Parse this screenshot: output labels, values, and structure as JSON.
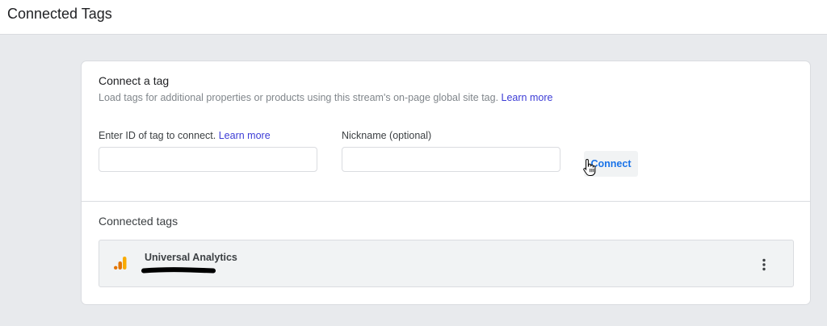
{
  "header": {
    "title": "Connected Tags"
  },
  "connect_section": {
    "title": "Connect a tag",
    "description": "Load tags for additional properties or products using this stream's on-page global site tag.",
    "description_link": "Learn more",
    "tag_id_label": "Enter ID of tag to connect.",
    "tag_id_link": "Learn more",
    "tag_id_value": "",
    "nickname_label": "Nickname (optional)",
    "nickname_value": "",
    "connect_button": "Connect"
  },
  "connected_section": {
    "title": "Connected tags",
    "items": [
      {
        "name": "Universal Analytics",
        "icon": "analytics-icon",
        "menu_icon": "more-vert-icon"
      }
    ]
  },
  "colors": {
    "link": "#3c3cd6",
    "button_text": "#1a73e8",
    "analytics_orange": "#f9ab00",
    "analytics_dark": "#e37400"
  }
}
